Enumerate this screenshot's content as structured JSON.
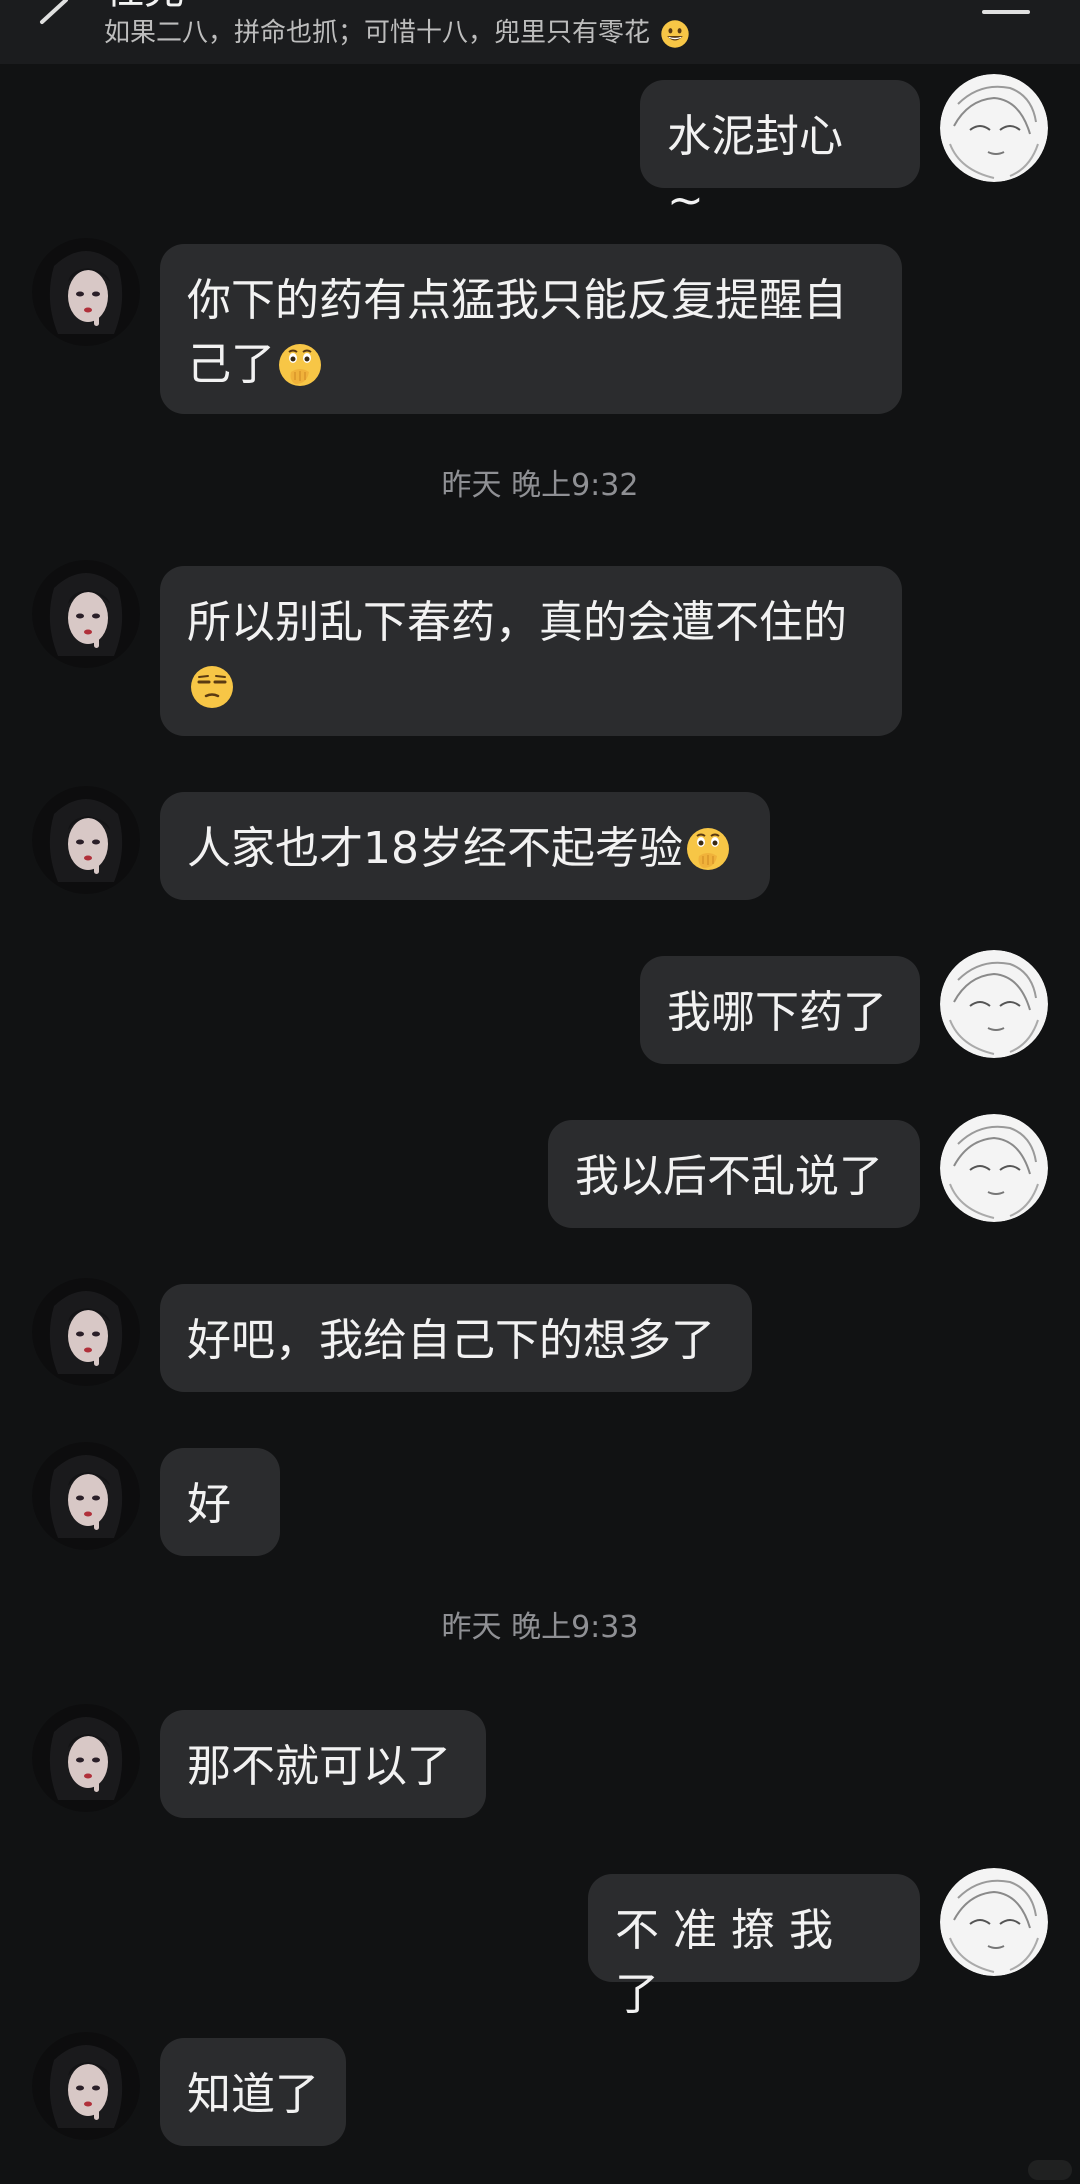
{
  "header": {
    "title": "杜克",
    "subtitle": "如果二八，拼命也抓；可惜十八，兜里只有零花"
  },
  "messages": [
    {
      "side": "right",
      "text": "水泥封心 ~",
      "emoji": ""
    },
    {
      "side": "left",
      "text_line1": "你下的药有点猛我只能反复提醒自",
      "text_line2": "己了",
      "emoji": "thinking-hand-over-mouth-face"
    },
    {
      "type": "time",
      "text": "昨天 晚上9:32"
    },
    {
      "side": "left",
      "text": "所以别乱下春药，真的会遭不住的",
      "emoji": "unamused-face"
    },
    {
      "side": "left",
      "text": "人家也才18岁经不起考验",
      "emoji": "thinking-hand-over-mouth-face"
    },
    {
      "side": "right",
      "text": "我哪下药了",
      "emoji": ""
    },
    {
      "side": "right",
      "text": "我以后不乱说了",
      "emoji": ""
    },
    {
      "side": "left",
      "text": "好吧，我给自己下的想多了",
      "emoji": ""
    },
    {
      "side": "left",
      "text": "好",
      "emoji": ""
    },
    {
      "type": "time",
      "text": "昨天 晚上9:33"
    },
    {
      "side": "left",
      "text": "那不就可以了",
      "emoji": ""
    },
    {
      "side": "right",
      "text": "不准撩我了",
      "emoji": ""
    },
    {
      "side": "left",
      "text": "知道了",
      "emoji": ""
    }
  ],
  "colors": {
    "background": "#111213",
    "bubble": "#2b2c2e",
    "header": "#1b1c1e",
    "timestamp": "#8f9094",
    "text": "#f2f2f2"
  },
  "icons": {
    "back": "chevron-left-icon",
    "menu": "menu-icon",
    "header_emoji": "grinning-face-emoji"
  }
}
